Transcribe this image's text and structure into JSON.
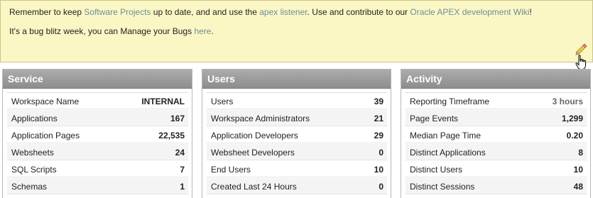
{
  "notice": {
    "line1": {
      "t1": "Remember to keep ",
      "link1": "Software Projects",
      "t2": " up to date, and and use the ",
      "link2": "apex listener",
      "t3": ". Use and contribute to our ",
      "link3": "Oracle APEX development Wiki",
      "t4": "!"
    },
    "line2": {
      "t1": "It's a bug blitz week, you can Manage your Bugs ",
      "link1": "here",
      "t2": "."
    },
    "edit_icon": "pencil-icon",
    "cursor_icon": "hand-pointer-icon"
  },
  "regions": [
    {
      "title": "Service",
      "rows": [
        {
          "label": "Workspace Name",
          "value": "INTERNAL"
        },
        {
          "label": "Applications",
          "value": "167"
        },
        {
          "label": "Application Pages",
          "value": "22,535"
        },
        {
          "label": "Websheets",
          "value": "24"
        },
        {
          "label": "SQL Scripts",
          "value": "7"
        },
        {
          "label": "Schemas",
          "value": "1"
        }
      ]
    },
    {
      "title": "Users",
      "rows": [
        {
          "label": "Users",
          "value": "39"
        },
        {
          "label": "Workspace Administrators",
          "value": "21"
        },
        {
          "label": "Application Developers",
          "value": "29"
        },
        {
          "label": "Websheet Developers",
          "value": "0"
        },
        {
          "label": "End Users",
          "value": "10"
        },
        {
          "label": "Created Last 24 Hours",
          "value": "0"
        }
      ]
    },
    {
      "title": "Activity",
      "rows": [
        {
          "label": "Reporting Timeframe",
          "value": "3 hours"
        },
        {
          "label": "Page Events",
          "value": "1,299"
        },
        {
          "label": "Median Page Time",
          "value": "0.20"
        },
        {
          "label": "Distinct Applications",
          "value": "8"
        },
        {
          "label": "Distinct Users",
          "value": "10"
        },
        {
          "label": "Distinct Sessions",
          "value": "48"
        }
      ]
    }
  ],
  "colors": {
    "notice_bg": "#fbf7c4",
    "link": "#6b8f9a",
    "header_bg": "#9c9c9c"
  }
}
